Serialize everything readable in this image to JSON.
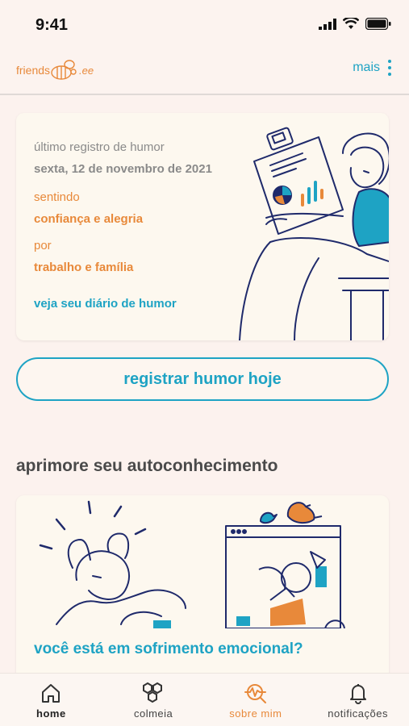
{
  "status_bar": {
    "time": "9:41"
  },
  "header": {
    "logo_text": "friends",
    "logo_suffix": ".ee",
    "more_label": "mais"
  },
  "mood_card": {
    "last_record_label": "último registro de humor",
    "date": "sexta, 12 de novembro de 2021",
    "feeling_label": "sentindo",
    "feeling_value": "confiança e alegria",
    "reason_label": "por",
    "reason_value": "trabalho e família",
    "diary_link": "veja seu diário de humor"
  },
  "register_button": "registrar humor hoje",
  "section": {
    "title": "aprimore seu autoconhecimento",
    "card_title": "você está em sofrimento emocional?"
  },
  "bottom_nav": {
    "items": [
      {
        "label": "home",
        "icon": "home-icon"
      },
      {
        "label": "colmeia",
        "icon": "hive-icon"
      },
      {
        "label": "sobre mim",
        "icon": "heartbeat-icon"
      },
      {
        "label": "notificações",
        "icon": "bell-icon"
      }
    ]
  },
  "colors": {
    "accent": "#1ea3c4",
    "orange": "#e8893a",
    "navy": "#1f2a6b",
    "background": "#fcf2ee"
  }
}
